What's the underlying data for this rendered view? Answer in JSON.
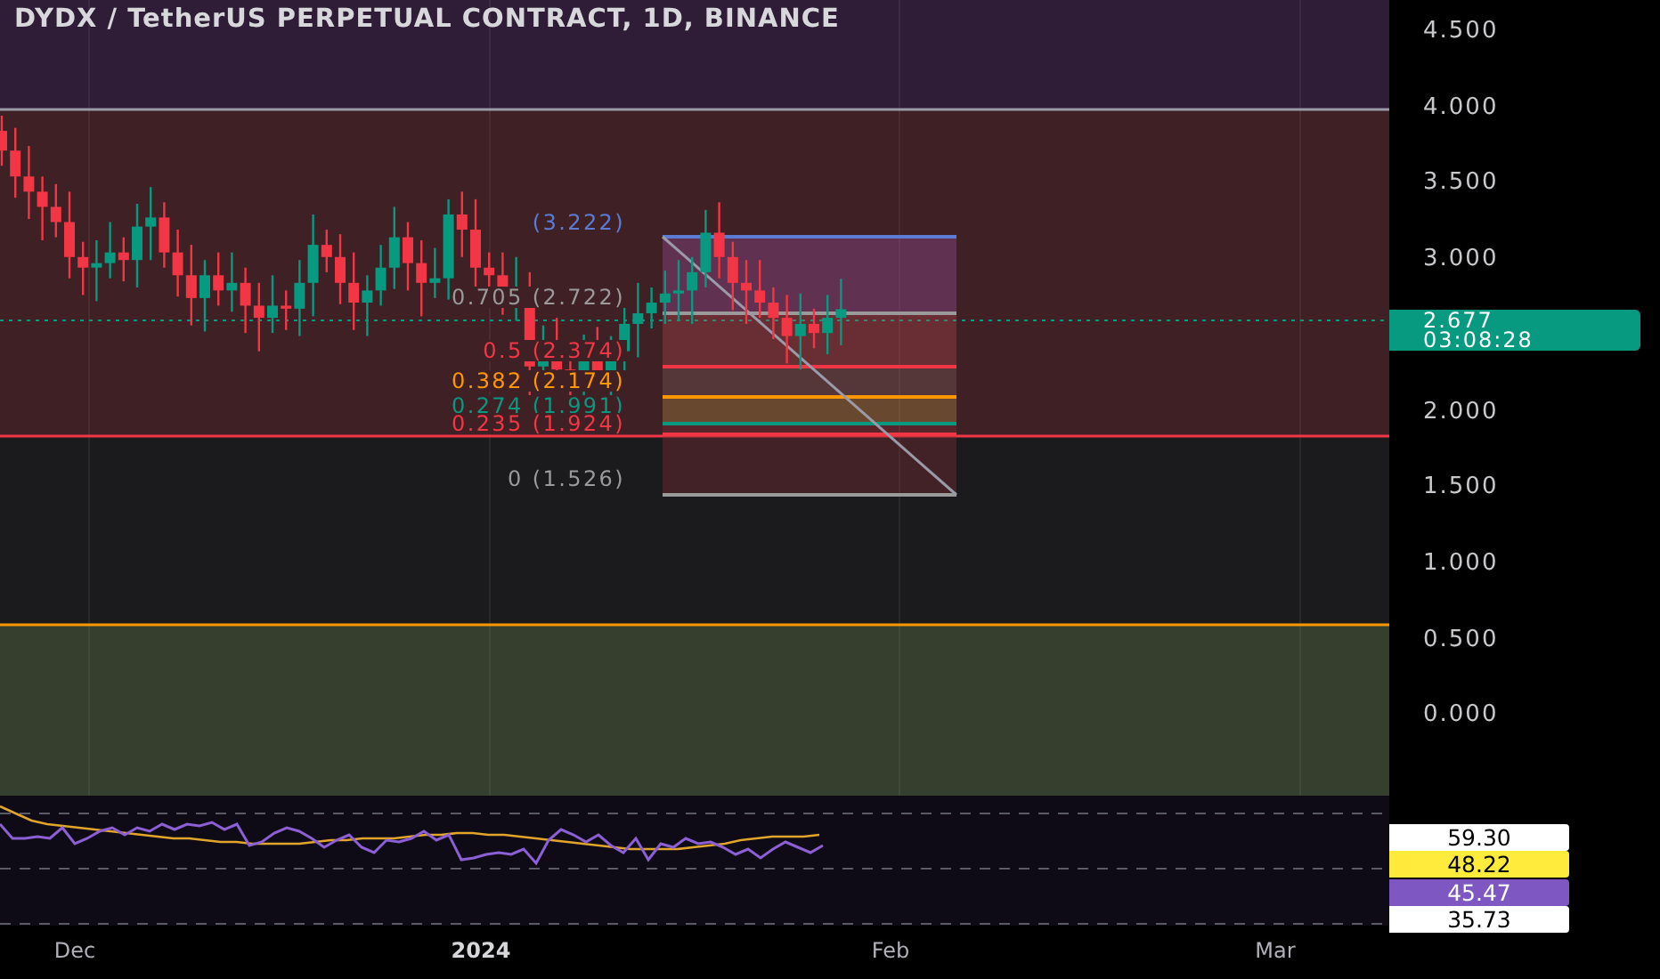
{
  "chart": {
    "title": "DYDX / TetherUS PERPETUAL CONTRACT, 1D, BINANCE"
  },
  "fib_levels": [
    {
      "label": "(3.222)",
      "color": "#5b7bd5"
    },
    {
      "label": "0.705 (2.722)",
      "color": "#9a9a9a"
    },
    {
      "label": "0.5 (2.374)",
      "color": "#f23645"
    },
    {
      "label": "0.382 (2.174)",
      "color": "#ff9800"
    },
    {
      "label": "0.274 (1.991)",
      "color": "#089981"
    },
    {
      "label": "0.235 (1.924)",
      "color": "#f23645"
    },
    {
      "label": "0 (1.526)",
      "color": "#9a9a9a"
    }
  ],
  "price_axis": [
    "4.500",
    "4.000",
    "3.500",
    "3.000",
    "2.000",
    "1.500",
    "1.000",
    "0.500",
    "0.000"
  ],
  "last_price": {
    "price": "2.677",
    "countdown": "03:08:28"
  },
  "rsi_labels": [
    {
      "value": "59.30",
      "color": "#ffffff"
    },
    {
      "value": "48.22",
      "color": "#ffeb3b"
    },
    {
      "value": "45.47",
      "color": "#7e57c2"
    },
    {
      "value": "35.73",
      "color": "#ffffff"
    }
  ],
  "time_axis": [
    {
      "label": "Dec",
      "kind": "month"
    },
    {
      "label": "2024",
      "kind": "year"
    },
    {
      "label": "Feb",
      "kind": "month"
    },
    {
      "label": "Mar",
      "kind": "month"
    }
  ]
}
